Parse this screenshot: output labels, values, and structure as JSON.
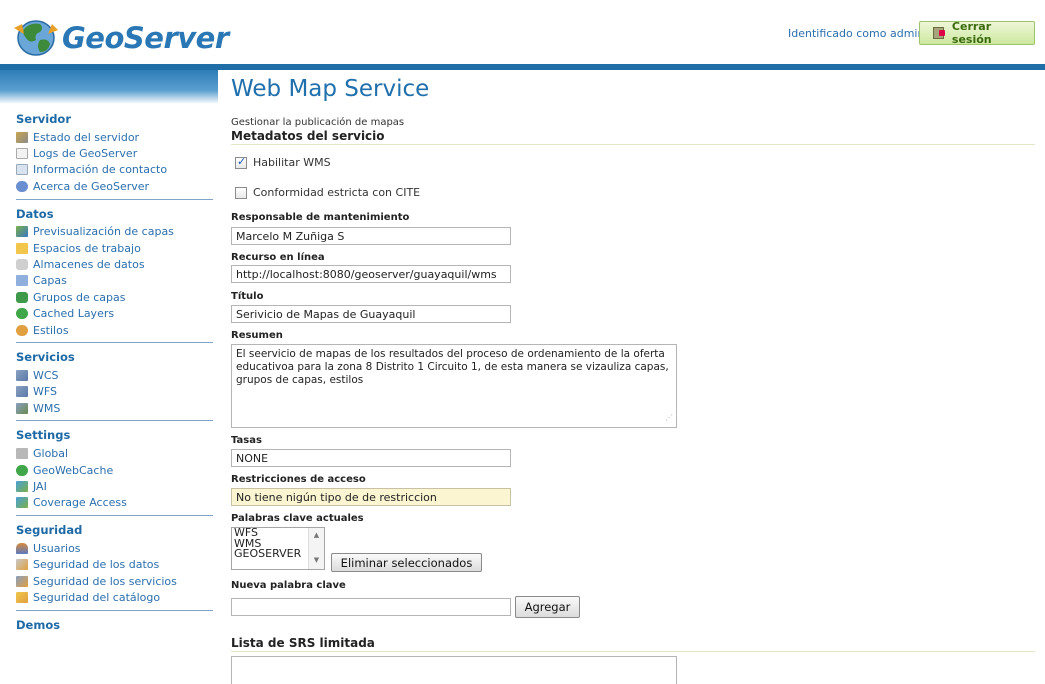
{
  "header": {
    "logo_text": "GeoServer",
    "login_text": "Identificado como admin.",
    "logout_label": "Cerrar sesión"
  },
  "sidebar": {
    "sections": [
      {
        "title": "Servidor",
        "items": [
          {
            "label": "Estado del servidor",
            "icon": "server-status-icon"
          },
          {
            "label": "Logs de GeoServer",
            "icon": "log-file-icon"
          },
          {
            "label": "Información de contacto",
            "icon": "contact-card-icon"
          },
          {
            "label": "Acerca de GeoServer",
            "icon": "info-icon"
          }
        ]
      },
      {
        "title": "Datos",
        "items": [
          {
            "label": "Previsualización de capas",
            "icon": "layer-preview-icon"
          },
          {
            "label": "Espacios de trabajo",
            "icon": "folder-icon"
          },
          {
            "label": "Almacenes de datos",
            "icon": "database-icon"
          },
          {
            "label": "Capas",
            "icon": "layer-icon"
          },
          {
            "label": "Grupos de capas",
            "icon": "layer-group-icon"
          },
          {
            "label": "Cached Layers",
            "icon": "globe-icon"
          },
          {
            "label": "Estilos",
            "icon": "palette-icon"
          }
        ]
      },
      {
        "title": "Servicios",
        "items": [
          {
            "label": "WCS",
            "icon": "service-icon"
          },
          {
            "label": "WFS",
            "icon": "service-icon"
          },
          {
            "label": "WMS",
            "icon": "service-icon"
          }
        ]
      },
      {
        "title": "Settings",
        "items": [
          {
            "label": "Global",
            "icon": "settings-icon"
          },
          {
            "label": "GeoWebCache",
            "icon": "globe-icon"
          },
          {
            "label": "JAI",
            "icon": "image-icon"
          },
          {
            "label": "Coverage Access",
            "icon": "image-icon"
          }
        ]
      },
      {
        "title": "Seguridad",
        "items": [
          {
            "label": "Usuarios",
            "icon": "user-icon"
          },
          {
            "label": "Seguridad de los datos",
            "icon": "data-security-icon"
          },
          {
            "label": "Seguridad de los servicios",
            "icon": "service-security-icon"
          },
          {
            "label": "Seguridad del catálogo",
            "icon": "catalog-security-icon"
          }
        ]
      },
      {
        "title": "Demos",
        "items": []
      }
    ]
  },
  "main": {
    "title": "Web Map Service",
    "description": "Gestionar la publicación de mapas",
    "metadata_heading": "Metadatos del servicio",
    "enable_wms_label": "Habilitar WMS",
    "enable_wms_checked": true,
    "cite_label": "Conformidad estricta con CITE",
    "cite_checked": false,
    "maintainer_label": "Responsable de mantenimiento",
    "maintainer_value": "Marcelo M Zuñiga S",
    "online_resource_label": "Recurso en línea",
    "online_resource_value": "http://localhost:8080/geoserver/guayaquil/wms",
    "title_label": "Título",
    "title_value": "Serivicio de Mapas de Guayaquil",
    "abstract_label": "Resumen",
    "abstract_value": "El seervicio de mapas de los resultados del proceso de ordenamiento de la oferta educativoa para la zona 8 Distrito 1 Circuito 1, de esta manera se vizauliza capas, grupos de capas, estilos",
    "fees_label": "Tasas",
    "fees_value": "NONE",
    "access_label": "Restricciones de acceso",
    "access_value": "No tiene nigún tipo de de restriccion",
    "keywords_label": "Palabras clave actuales",
    "keywords": [
      "WFS",
      "WMS",
      "GEOSERVER"
    ],
    "remove_selected_label": "Eliminar seleccionados",
    "new_keyword_label": "Nueva palabra clave",
    "new_keyword_value": "",
    "add_label": "Agregar",
    "srs_heading": "Lista de SRS limitada"
  },
  "colors": {
    "brand_blue": "#1f6ea8",
    "link_blue": "#2b6fad",
    "logout_green": "#cde8a0",
    "restriction_yellow": "#fbf6d1"
  }
}
